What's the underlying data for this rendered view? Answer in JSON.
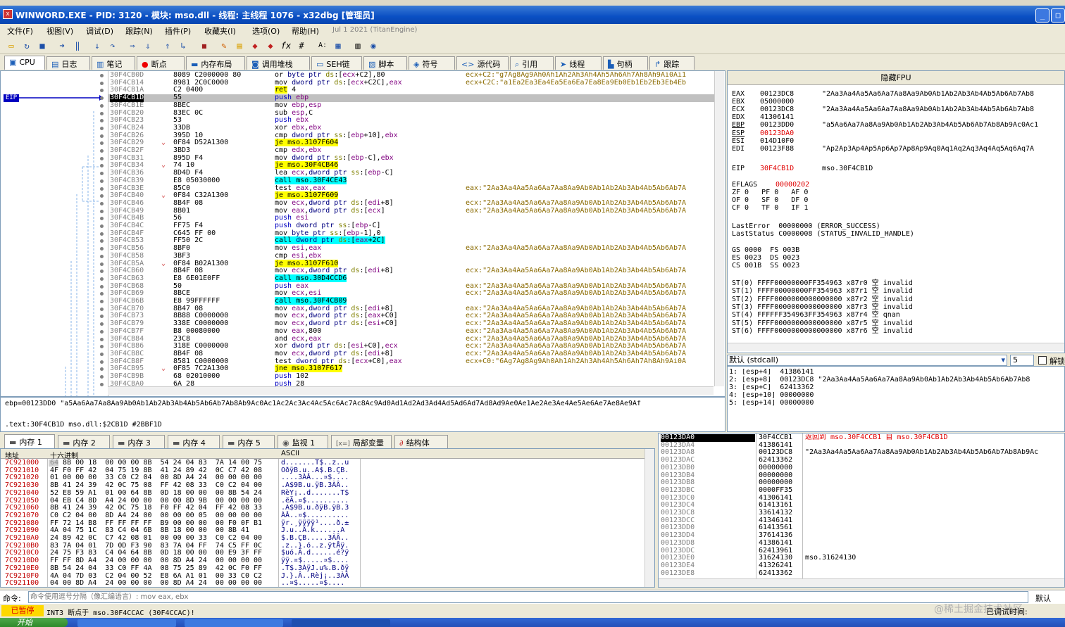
{
  "window": {
    "title": "WINWORD.EXE - PID: 3120 - 模块: mso.dll - 线程: 主线程 1076 - x32dbg [管理员]"
  },
  "menu": {
    "items": [
      "文件(F)",
      "视图(V)",
      "调试(D)",
      "跟踪(N)",
      "插件(P)",
      "收藏夹(I)",
      "选项(O)",
      "帮助(H)"
    ],
    "build_date": "Jul 1 2021 (TitanEngine)"
  },
  "tabs_top": [
    {
      "icon": "cpu-icon",
      "label": "CPU"
    },
    {
      "icon": "log-icon",
      "label": "日志"
    },
    {
      "icon": "notes-icon",
      "label": "笔记"
    },
    {
      "icon": "breakpoint-icon",
      "label": "断点"
    },
    {
      "icon": "memory-map-icon",
      "label": "内存布局"
    },
    {
      "icon": "callstack-icon",
      "label": "调用堆栈"
    },
    {
      "icon": "seh-icon",
      "label": "SEH链"
    },
    {
      "icon": "script-icon",
      "label": "脚本"
    },
    {
      "icon": "symbol-icon",
      "label": "符号"
    },
    {
      "icon": "source-icon",
      "label": "源代码"
    },
    {
      "icon": "references-icon",
      "label": "引用"
    },
    {
      "icon": "threads-icon",
      "label": "线程"
    },
    {
      "icon": "handles-icon",
      "label": "句柄"
    },
    {
      "icon": "trace-icon",
      "label": "跟踪"
    }
  ],
  "eip_label": "EIP",
  "disasm": [
    {
      "addr": "30F4CB0D",
      "bytes": "8089 C2000000 80",
      "ins": "or byte ptr ds:[ecx+C2],80",
      "cmt": "ecx+C2:\"g7Ag8Ag9Ah0Ah1Ah2Ah3Ah4Ah5Ah6Ah7Ah8Ah9Ai0Ai1"
    },
    {
      "addr": "30F4CB14",
      "bytes": "8981 2C0C0000",
      "ins": "mov dword ptr ds:[ecx+C2C],eax",
      "cmt": "ecx+C2C:\"a1Ea2Ea3Ea4Ea5Ea6Ea7Ea8Ea9Eb0Eb1Eb2Eb3Eb4Eb"
    },
    {
      "addr": "30F4CB1A",
      "bytes": "C2 0400",
      "ins": "ret 4",
      "cmt": ""
    },
    {
      "addr": "30F4CB1D",
      "bytes": "55",
      "ins": "push ebp",
      "cmt": ""
    },
    {
      "addr": "30F4CB1E",
      "bytes": "8BEC",
      "ins": "mov ebp,esp",
      "cmt": ""
    },
    {
      "addr": "30F4CB20",
      "bytes": "83EC 0C",
      "ins": "sub esp,C",
      "cmt": ""
    },
    {
      "addr": "30F4CB23",
      "bytes": "53",
      "ins": "push ebx",
      "cmt": ""
    },
    {
      "addr": "30F4CB24",
      "bytes": "33DB",
      "ins": "xor ebx,ebx",
      "cmt": ""
    },
    {
      "addr": "30F4CB26",
      "bytes": "395D 10",
      "ins": "cmp dword ptr ss:[ebp+10],ebx",
      "cmt": ""
    },
    {
      "addr": "30F4CB29",
      "bytes": "0F84 D52A1300",
      "ins": "je mso.3107F604",
      "cmt": ""
    },
    {
      "addr": "30F4CB2F",
      "bytes": "3BD3",
      "ins": "cmp edx,ebx",
      "cmt": ""
    },
    {
      "addr": "30F4CB31",
      "bytes": "895D F4",
      "ins": "mov dword ptr ss:[ebp-C],ebx",
      "cmt": ""
    },
    {
      "addr": "30F4CB34",
      "bytes": "74 10",
      "ins": "je mso.30F4CB46",
      "cmt": ""
    },
    {
      "addr": "30F4CB36",
      "bytes": "8D4D F4",
      "ins": "lea ecx,dword ptr ss:[ebp-C]",
      "cmt": ""
    },
    {
      "addr": "30F4CB39",
      "bytes": "E8 05030000",
      "ins": "call mso.30F4CE43",
      "cmt": ""
    },
    {
      "addr": "30F4CB3E",
      "bytes": "85C0",
      "ins": "test eax,eax",
      "cmt": "eax:\"2Aa3Aa4Aa5Aa6Aa7Aa8Aa9Ab0Ab1Ab2Ab3Ab4Ab5Ab6Ab7A"
    },
    {
      "addr": "30F4CB40",
      "bytes": "0F84 C32A1300",
      "ins": "je mso.3107F609",
      "cmt": ""
    },
    {
      "addr": "30F4CB46",
      "bytes": "8B4F 08",
      "ins": "mov ecx,dword ptr ds:[edi+8]",
      "cmt": "ecx:\"2Aa3Aa4Aa5Aa6Aa7Aa8Aa9Ab0Ab1Ab2Ab3Ab4Ab5Ab6Ab7A"
    },
    {
      "addr": "30F4CB49",
      "bytes": "8B01",
      "ins": "mov eax,dword ptr ds:[ecx]",
      "cmt": "eax:\"2Aa3Aa4Aa5Aa6Aa7Aa8Aa9Ab0Ab1Ab2Ab3Ab4Ab5Ab6Ab7A"
    },
    {
      "addr": "30F4CB4B",
      "bytes": "56",
      "ins": "push esi",
      "cmt": ""
    },
    {
      "addr": "30F4CB4C",
      "bytes": "FF75 F4",
      "ins": "push dword ptr ss:[ebp-C]",
      "cmt": ""
    },
    {
      "addr": "30F4CB4F",
      "bytes": "C645 FF 00",
      "ins": "mov byte ptr ss:[ebp-1],0",
      "cmt": ""
    },
    {
      "addr": "30F4CB53",
      "bytes": "FF50 2C",
      "ins": "call dword ptr ds:[eax+2C]",
      "cmt": ""
    },
    {
      "addr": "30F4CB56",
      "bytes": "8BF0",
      "ins": "mov esi,eax",
      "cmt": "eax:\"2Aa3Aa4Aa5Aa6Aa7Aa8Aa9Ab0Ab1Ab2Ab3Ab4Ab5Ab6Ab7A"
    },
    {
      "addr": "30F4CB58",
      "bytes": "3BF3",
      "ins": "cmp esi,ebx",
      "cmt": ""
    },
    {
      "addr": "30F4CB5A",
      "bytes": "0F84 B02A1300",
      "ins": "je mso.3107F610",
      "cmt": ""
    },
    {
      "addr": "30F4CB60",
      "bytes": "8B4F 08",
      "ins": "mov ecx,dword ptr ds:[edi+8]",
      "cmt": "ecx:\"2Aa3Aa4Aa5Aa6Aa7Aa8Aa9Ab0Ab1Ab2Ab3Ab4Ab5Ab6Ab7A"
    },
    {
      "addr": "30F4CB63",
      "bytes": "E8 6E01E0FF",
      "ins": "call mso.30D4CCD6",
      "cmt": ""
    },
    {
      "addr": "30F4CB68",
      "bytes": "50",
      "ins": "push eax",
      "cmt": "eax:\"2Aa3Aa4Aa5Aa6Aa7Aa8Aa9Ab0Ab1Ab2Ab3Ab4Ab5Ab6Ab7A"
    },
    {
      "addr": "30F4CB69",
      "bytes": "8BCE",
      "ins": "mov ecx,esi",
      "cmt": "ecx:\"2Aa3Aa4Aa5Aa6Aa7Aa8Aa9Ab0Ab1Ab2Ab3Ab4Ab5Ab6Ab7A"
    },
    {
      "addr": "30F4CB6B",
      "bytes": "E8 99FFFFFF",
      "ins": "call mso.30F4CB09",
      "cmt": ""
    },
    {
      "addr": "30F4CB70",
      "bytes": "8B47 08",
      "ins": "mov eax,dword ptr ds:[edi+8]",
      "cmt": "eax:\"2Aa3Aa4Aa5Aa6Aa7Aa8Aa9Ab0Ab1Ab2Ab3Ab4Ab5Ab6Ab7A"
    },
    {
      "addr": "30F4CB73",
      "bytes": "8B88 C0000000",
      "ins": "mov ecx,dword ptr ds:[eax+C0]",
      "cmt": "ecx:\"2Aa3Aa4Aa5Aa6Aa7Aa8Aa9Ab0Ab1Ab2Ab3Ab4Ab5Ab6Ab7A"
    },
    {
      "addr": "30F4CB79",
      "bytes": "338E C0000000",
      "ins": "mov ecx,dword ptr ds:[esi+C0]",
      "cmt": "ecx:\"2Aa3Aa4Aa5Aa6Aa7Aa8Aa9Ab0Ab1Ab2Ab3Ab4Ab5Ab6Ab7A"
    },
    {
      "addr": "30F4CB7F",
      "bytes": "B8 00080000",
      "ins": "mov eax,800",
      "cmt": "eax:\"2Aa3Aa4Aa5Aa6Aa7Aa8Aa9Ab0Ab1Ab2Ab3Ab4Ab5Ab6Ab7A"
    },
    {
      "addr": "30F4CB84",
      "bytes": "23C8",
      "ins": "and ecx,eax",
      "cmt": "ecx:\"2Aa3Aa4Aa5Aa6Aa7Aa8Aa9Ab0Ab1Ab2Ab3Ab4Ab5Ab6Ab7A"
    },
    {
      "addr": "30F4CB86",
      "bytes": "318E C0000000",
      "ins": "xor dword ptr ds:[esi+C0],ecx",
      "cmt": "ecx:\"2Aa3Aa4Aa5Aa6Aa7Aa8Aa9Ab0Ab1Ab2Ab3Ab4Ab5Ab6Ab7A"
    },
    {
      "addr": "30F4CB8C",
      "bytes": "8B4F 08",
      "ins": "mov ecx,dword ptr ds:[edi+8]",
      "cmt": "ecx:\"2Aa3Aa4Aa5Aa6Aa7Aa8Aa9Ab0Ab1Ab2Ab3Ab4Ab5Ab6Ab7A"
    },
    {
      "addr": "30F4CB8F",
      "bytes": "8581 C0000000",
      "ins": "test dword ptr ds:[ecx+C0],eax",
      "cmt": "ecx+C0:\"6Ag7Ag8Ag9Ah0Ah1Ah2Ah3Ah4Ah5Ah6Ah7Ah8Ah9Ai0A"
    },
    {
      "addr": "30F4CB95",
      "bytes": "0F85 7C2A1300",
      "ins": "jne mso.3107F617",
      "cmt": ""
    },
    {
      "addr": "30F4CB9B",
      "bytes": "68 02010000",
      "ins": "push 102",
      "cmt": ""
    },
    {
      "addr": "30F4CBA0",
      "bytes": "6A 28",
      "ins": "push 28",
      "cmt": ""
    }
  ],
  "info": {
    "line1": "ebp=00123DD0 \"a5Aa6Aa7Aa8Aa9Ab0Ab1Ab2Ab3Ab4Ab5Ab6Ab7Ab8Ab9Ac0Ac1Ac2Ac3Ac4Ac5Ac6Ac7Ac8Ac9Ad0Ad1Ad2Ad3Ad4Ad5Ad6Ad7Ad8Ad9Ae0Ae1Ae2Ae3Ae4Ae5Ae6Ae7Ae8Ae9Af",
    "line2": ".text:30F4CB1D mso.dll:$2CB1D #2BBF1D"
  },
  "regs": {
    "header": "隐藏FPU",
    "general": [
      {
        "name": "EAX",
        "val": "00123DC8",
        "cmt": "\"2Aa3Aa4Aa5Aa6Aa7Aa8Aa9Ab0Ab1Ab2Ab3Ab4Ab5Ab6Ab7Ab8"
      },
      {
        "name": "EBX",
        "val": "05000000",
        "cmt": ""
      },
      {
        "name": "ECX",
        "val": "00123DC8",
        "cmt": "\"2Aa3Aa4Aa5Aa6Aa7Aa8Aa9Ab0Ab1Ab2Ab3Ab4Ab5Ab6Ab7Ab8"
      },
      {
        "name": "EDX",
        "val": "41306141",
        "cmt": ""
      },
      {
        "name": "EBP",
        "val": "00123DD0",
        "cmt": "\"a5Aa6Aa7Aa8Aa9Ab0Ab1Ab2Ab3Ab4Ab5Ab6Ab7Ab8Ab9Ac0Ac1"
      },
      {
        "name": "ESP",
        "val": "00123DA0",
        "cmt": ""
      },
      {
        "name": "ESI",
        "val": "014D10F0",
        "cmt": ""
      },
      {
        "name": "EDI",
        "val": "00123F88",
        "cmt": "\"Ap2Ap3Ap4Ap5Ap6Ap7Ap8Ap9Aq0Aq1Aq2Aq3Aq4Aq5Aq6Aq7A"
      }
    ],
    "eip": {
      "name": "EIP",
      "val": "30F4CB1D",
      "cmt": "mso.30F4CB1D"
    },
    "eflags": {
      "name": "EFLAGS",
      "val": "00000202"
    },
    "flags": [
      "ZF 0   PF 0   AF 0",
      "OF 0   SF 0   DF 0",
      "CF 0   TF 0   IF 1"
    ],
    "lasterror": "LastError  00000000 (ERROR_SUCCESS)",
    "laststatus": "LastStatus C0000008 (STATUS_INVALID_HANDLE)",
    "segs": [
      "GS 0000  FS 003B",
      "ES 0023  DS 0023",
      "CS 001B  SS 0023"
    ],
    "fpu": [
      "ST(0) FFFF00000000FF354963 x87r0 空 invalid",
      "ST(1) FFFF00000000FF354963 x87r1 空 invalid",
      "ST(2) FFFF0000000000000000 x87r2 空 invalid",
      "ST(3) FFFF0000000000000000 x87r3 空 invalid",
      "ST(4) FFFFFF354963FF354963 x87r4 空 qnan",
      "ST(5) FFFF0000000000000000 x87r5 空 invalid",
      "ST(6) FFFF0000000000000000 x87r6 空 invalid"
    ]
  },
  "callconv": {
    "label": "默认 (stdcall)",
    "count": "5",
    "unlock": "解锁"
  },
  "args": [
    "1: [esp+4]  41386141",
    "2: [esp+8]  00123DC8 \"2Aa3Aa4Aa5Aa6Aa7Aa8Aa9Ab0Ab1Ab2Ab3Ab4Ab5Ab6Ab7Ab8",
    "3: [esp+C]  62413362",
    "4: [esp+10] 00000000",
    "5: [esp+14] 00000000"
  ],
  "tabs_bottom": [
    {
      "icon": "memory-icon",
      "label": "内存 1"
    },
    {
      "icon": "memory-icon",
      "label": "内存 2"
    },
    {
      "icon": "memory-icon",
      "label": "内存 3"
    },
    {
      "icon": "memory-icon",
      "label": "内存 4"
    },
    {
      "icon": "memory-icon",
      "label": "内存 5"
    },
    {
      "icon": "watch-icon",
      "label": "监视 1"
    },
    {
      "icon": "locals-icon",
      "label": "局部变量"
    },
    {
      "icon": "struct-icon",
      "label": "结构体"
    }
  ],
  "dump": {
    "headers": [
      "地址",
      "十六进制",
      "ASCII"
    ],
    "rows": [
      {
        "a": "7C921000",
        "h": "64 8B 00 18  00 00 00 8B  54 24 04 83  7A 14 00 75",
        "s": "d.......T$..z..u"
      },
      {
        "a": "7C921010",
        "h": "4F F0 FF 42  04 75 19 8B  41 24 89 42  0C C7 42 08",
        "s": "OðÿB.u..A$.B.ÇB."
      },
      {
        "a": "7C921020",
        "h": "01 00 00 00  33 C0 C2 04  00 8D A4 24  00 00 00 00",
        "s": "....3ÀÂ...¤$...."
      },
      {
        "a": "7C921030",
        "h": "8B 41 24 39  42 0C 75 08  FF 42 08 33  C0 C2 04 00",
        "s": ".A$9B.u.ÿB.3ÀÂ.."
      },
      {
        "a": "7C921040",
        "h": "52 E8 59 A1  01 00 64 8B  0D 18 00 00  00 8B 54 24",
        "s": "RèY¡..d.......T$"
      },
      {
        "a": "7C921050",
        "h": "04 EB C4 8D  A4 24 00 00  00 00 8D 9B  00 00 00 00",
        "s": ".ëÄ.¤$.........."
      },
      {
        "a": "7C921060",
        "h": "8B 41 24 39  42 0C 75 18  F0 FF 42 04  FF 42 08 33",
        "s": ".A$9B.u.ðÿB.ÿB.3"
      },
      {
        "a": "7C921070",
        "h": "C0 C2 04 00  8D A4 24 00  00 00 00 05  00 00 00 00",
        "s": "ÀÂ..¤$.........."
      },
      {
        "a": "7C921080",
        "h": "FF 72 14 B8  FF FF FF FF  B9 00 00 00  00 F0 0F B1",
        "s": "ÿr.¸ÿÿÿÿ¹....ð.±"
      },
      {
        "a": "7C921090",
        "h": "4A 04 75 1C  83 C4 04 6B  8B 18 00 00  00 8B 41",
        "s": "J.u..Ä.k......A"
      },
      {
        "a": "7C9210A0",
        "h": "24 89 42 0C  C7 42 08 01  00 00 00 33  C0 C2 04 00",
        "s": "$.B.ÇB.....3ÀÂ.."
      },
      {
        "a": "7C9210B0",
        "h": "83 7A 04 01  7D 0D F3 90  83 7A 04 FF  74 C5 FF 0C",
        "s": ".z..}.ó..z.ÿtÅÿ."
      },
      {
        "a": "7C9210C0",
        "h": "24 75 F3 83  C4 04 64 8B  0D 18 00 00  00 E9 3F FF",
        "s": "$uó.Ä.d......é?ÿ"
      },
      {
        "a": "7C9210D0",
        "h": "FF FF 8D A4  24 00 00 00  00 8D A4 24  00 00 00 00",
        "s": "ÿÿ.¤$.....¤$...."
      },
      {
        "a": "7C9210E0",
        "h": "8B 54 24 04  33 C0 FF 4A  08 75 25 89  42 0C F0 FF",
        "s": ".T$.3ÀÿJ.u%.B.ðÿ"
      },
      {
        "a": "7C9210F0",
        "h": "4A 04 7D 03  C2 04 00 52  E8 6A A1 01  00 33 C0 C2",
        "s": "J.}.Â..Rèj¡..3ÀÂ"
      },
      {
        "a": "7C921100",
        "h": "04 00 8D A4  24 00 00 00  00 8D A4 24  00 00 00 00",
        "s": "..¤$.....¤$...."
      }
    ]
  },
  "stack": [
    {
      "a": "00123DA0",
      "v": "30F4CCB1",
      "c": "返回到 mso.30F4CCB1 自 mso.30F4CB1D",
      "hl": true
    },
    {
      "a": "00123DA4",
      "v": "41386141",
      "c": ""
    },
    {
      "a": "00123DA8",
      "v": "00123DC8",
      "c": "\"2Aa3Aa4Aa5Aa6Aa7Aa8Aa9Ab0Ab1Ab2Ab3Ab4Ab5Ab6Ab7Ab8Ab9Ac"
    },
    {
      "a": "00123DAC",
      "v": "62413362",
      "c": ""
    },
    {
      "a": "00123DB0",
      "v": "00000000",
      "c": ""
    },
    {
      "a": "00123DB4",
      "v": "00000000",
      "c": ""
    },
    {
      "a": "00123DB8",
      "v": "00000000",
      "c": ""
    },
    {
      "a": "00123DBC",
      "v": "0000FF35",
      "c": ""
    },
    {
      "a": "00123DC0",
      "v": "41306141",
      "c": ""
    },
    {
      "a": "00123DC4",
      "v": "61413161",
      "c": ""
    },
    {
      "a": "00123DC8",
      "v": "33614132",
      "c": ""
    },
    {
      "a": "00123DCC",
      "v": "41346141",
      "c": ""
    },
    {
      "a": "00123DD0",
      "v": "61413561",
      "c": ""
    },
    {
      "a": "00123DD4",
      "v": "37614136",
      "c": ""
    },
    {
      "a": "00123DD8",
      "v": "41386141",
      "c": ""
    },
    {
      "a": "00123DDC",
      "v": "62413961",
      "c": ""
    },
    {
      "a": "00123DE0",
      "v": "31624130",
      "c": "mso.31624130"
    },
    {
      "a": "00123DE4",
      "v": "41326241",
      "c": ""
    },
    {
      "a": "00123DE8",
      "v": "62413362",
      "c": ""
    }
  ],
  "cmd": {
    "label": "命令:",
    "placeholder": "命令使用逗号分隔（像汇编语言）: mov eax, ebx",
    "right": "默认"
  },
  "status": {
    "state": "已暂停",
    "msg": "INT3 断点于 mso.30F4CCAC (30F4CCAC)!",
    "right": "已调试时间:",
    "watermark": "@稀土掘金技术社区"
  },
  "taskbar": {
    "start": "开始"
  }
}
